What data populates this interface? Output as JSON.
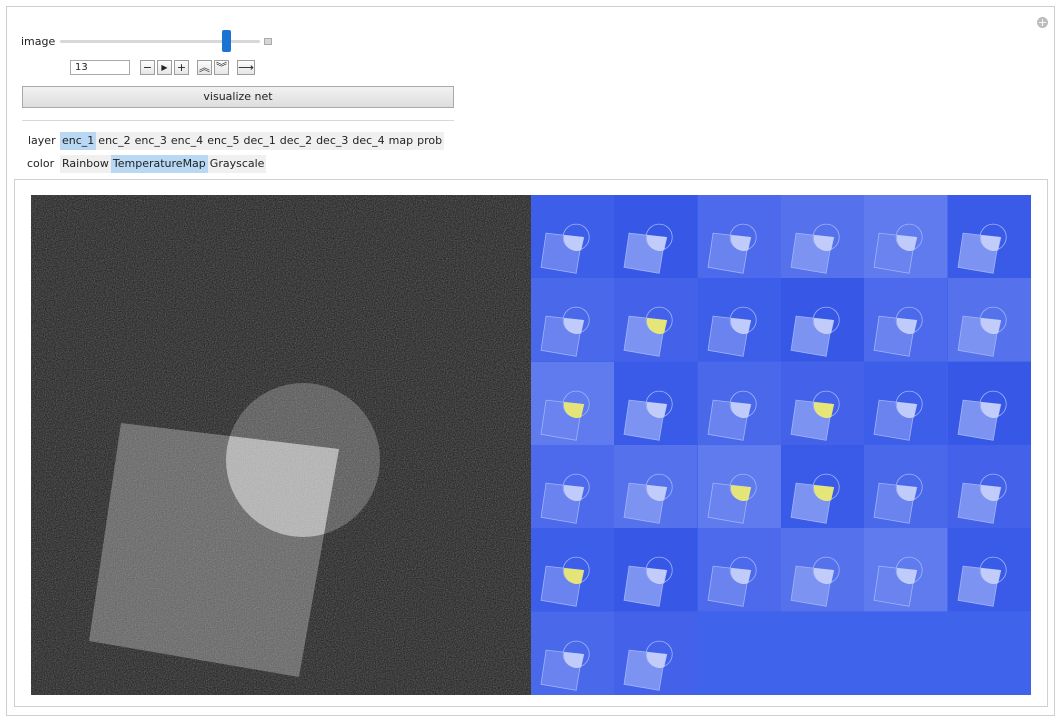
{
  "image_control": {
    "label": "image",
    "value": "13",
    "slider_fraction": 0.83
  },
  "buttons": {
    "decrement": "−",
    "play": "▶",
    "increment": "+",
    "faster": "︽",
    "slower": "︾",
    "direction": "⟶",
    "visualize": "visualize net"
  },
  "layer": {
    "label": "layer",
    "options": [
      "enc_1",
      "enc_2",
      "enc_3",
      "enc_4",
      "enc_5",
      "dec_1",
      "dec_2",
      "dec_3",
      "dec_4",
      "map",
      "prob"
    ],
    "selected": "enc_1"
  },
  "color": {
    "label": "color",
    "options": [
      "Rainbow",
      "TemperatureMap",
      "Grayscale"
    ],
    "selected": "TemperatureMap"
  },
  "feature_maps": {
    "count": 32,
    "columns": 6,
    "colors": {
      "base": "#3f63ea",
      "highlight": "#f2ee6a",
      "edge": "#9fb3f7"
    }
  },
  "icons": {
    "corner": "plus-circle-icon"
  }
}
